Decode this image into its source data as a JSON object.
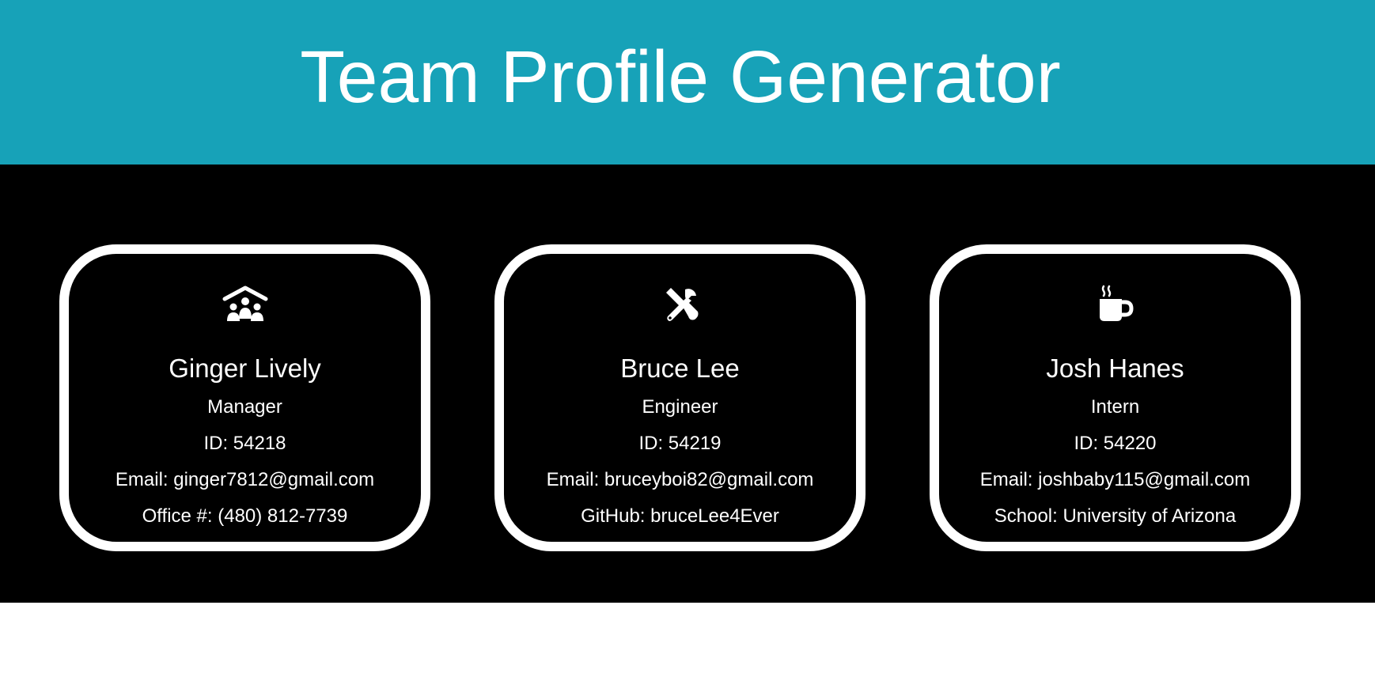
{
  "header": {
    "title": "Team Profile Generator"
  },
  "colors": {
    "header_bg": "#17a2b8",
    "band_bg": "#000000",
    "card_border": "#ffffff",
    "text": "#ffffff"
  },
  "team": [
    {
      "icon": "house-people-icon",
      "name": "Ginger Lively",
      "role": "Manager",
      "id": "ID: 54218",
      "email": "Email: ginger7812@gmail.com",
      "extra": "Office #: (480) 812-7739"
    },
    {
      "icon": "tools-icon",
      "name": "Bruce Lee",
      "role": "Engineer",
      "id": "ID: 54219",
      "email": "Email: bruceyboi82@gmail.com",
      "extra": "GitHub: bruceLee4Ever"
    },
    {
      "icon": "coffee-mug-icon",
      "name": "Josh Hanes",
      "role": "Intern",
      "id": "ID: 54220",
      "email": "Email: joshbaby115@gmail.com",
      "extra": "School: University of Arizona"
    }
  ]
}
